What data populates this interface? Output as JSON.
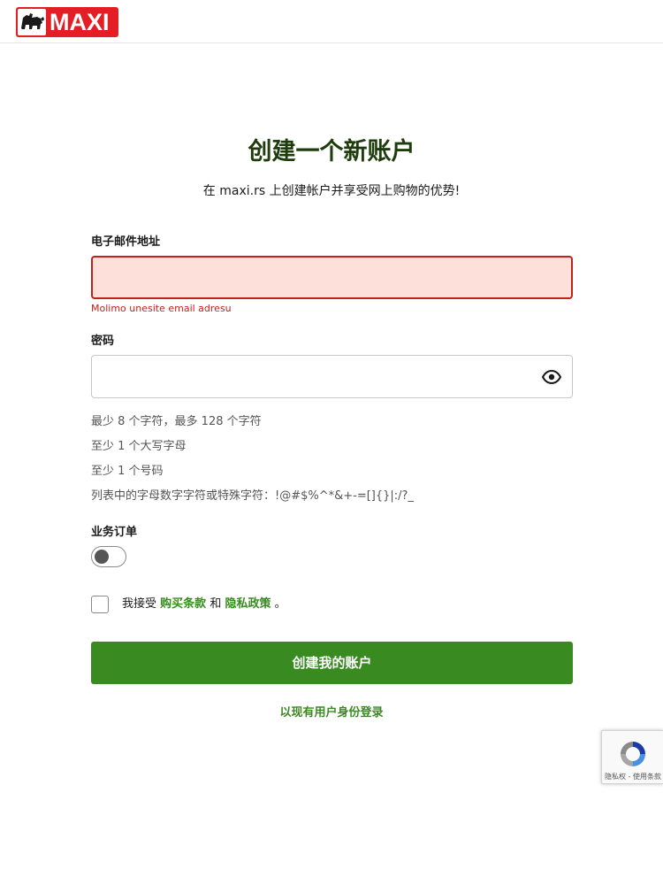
{
  "header": {
    "logo_text": "MAXI",
    "brand_color": "#e31e24"
  },
  "form": {
    "title": "创建一个新账户",
    "subtitle": "在 maxi.rs 上创建帐户并享受网上购物的优势!",
    "email": {
      "label": "电子邮件地址",
      "value": "",
      "placeholder": "",
      "error": "Molimo unesite email adresu"
    },
    "password": {
      "label": "密码",
      "value": "",
      "placeholder": "",
      "toggle_icon": "eye-icon"
    },
    "password_rules": [
      "最少 8 个字符，最多 128 个字符",
      "至少 1 个大写字母",
      "至少 1 个号码",
      "列表中的字母数字字符或特殊字符：!@#$%^*&+-=[]{}|:/?_"
    ],
    "business_order": {
      "label": "业务订单",
      "checked": false
    },
    "terms": {
      "prefix": "我接受",
      "purchase_terms": "购买条款",
      "and": "和",
      "privacy_policy": "隐私政策",
      "suffix": "。",
      "checked": false
    },
    "submit_label": "创建我的账户",
    "login_link": "以现有用户身份登录"
  },
  "recaptcha": {
    "text": "隐私权 - 使用条款"
  },
  "colors": {
    "accent_green": "#3a8a22",
    "title_green": "#1f3d0c",
    "error_red": "#c0221c",
    "error_bg": "#fde0d9"
  }
}
